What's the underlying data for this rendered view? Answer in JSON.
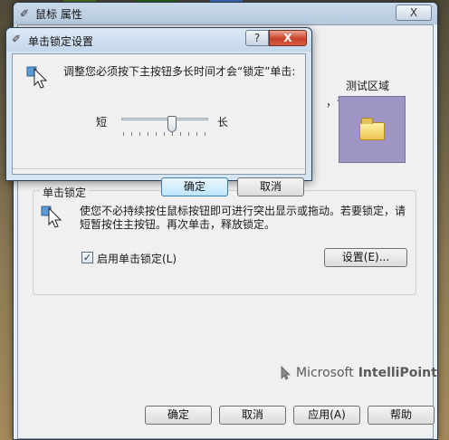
{
  "main_window": {
    "title": "鼠标 属性",
    "close_label": "X",
    "partial_text": "，请",
    "test_area_label": "测试区域",
    "click_lock": {
      "group_label": "单击锁定",
      "description": "使您不必持续按住鼠标按钮即可进行突出显示或拖动。若要锁定，请短暂按住主按钮。再次单击，释放锁定。",
      "checkbox_label": "启用单击锁定(L)",
      "checkbox_checked": true,
      "settings_button": "设置(E)..."
    },
    "brand": {
      "name_regular": "Microsoft",
      "name_bold": "IntelliPoint"
    },
    "buttons": {
      "ok": "确定",
      "cancel": "取消",
      "apply": "应用(A)",
      "help": "帮助"
    }
  },
  "dialog": {
    "title": "单击锁定设置",
    "help_label": "?",
    "close_label": "X",
    "description": "调整您必须按下主按钮多长时间才会“锁定”单击:",
    "slider": {
      "min_label": "短",
      "max_label": "长",
      "value_fraction": 0.5
    },
    "ok_button": "确定",
    "cancel_button": "取消"
  },
  "colors": {
    "test_area": "#9f95c4",
    "dialog_close": "#c8432b",
    "default_button_border": "#3c7fb1"
  }
}
